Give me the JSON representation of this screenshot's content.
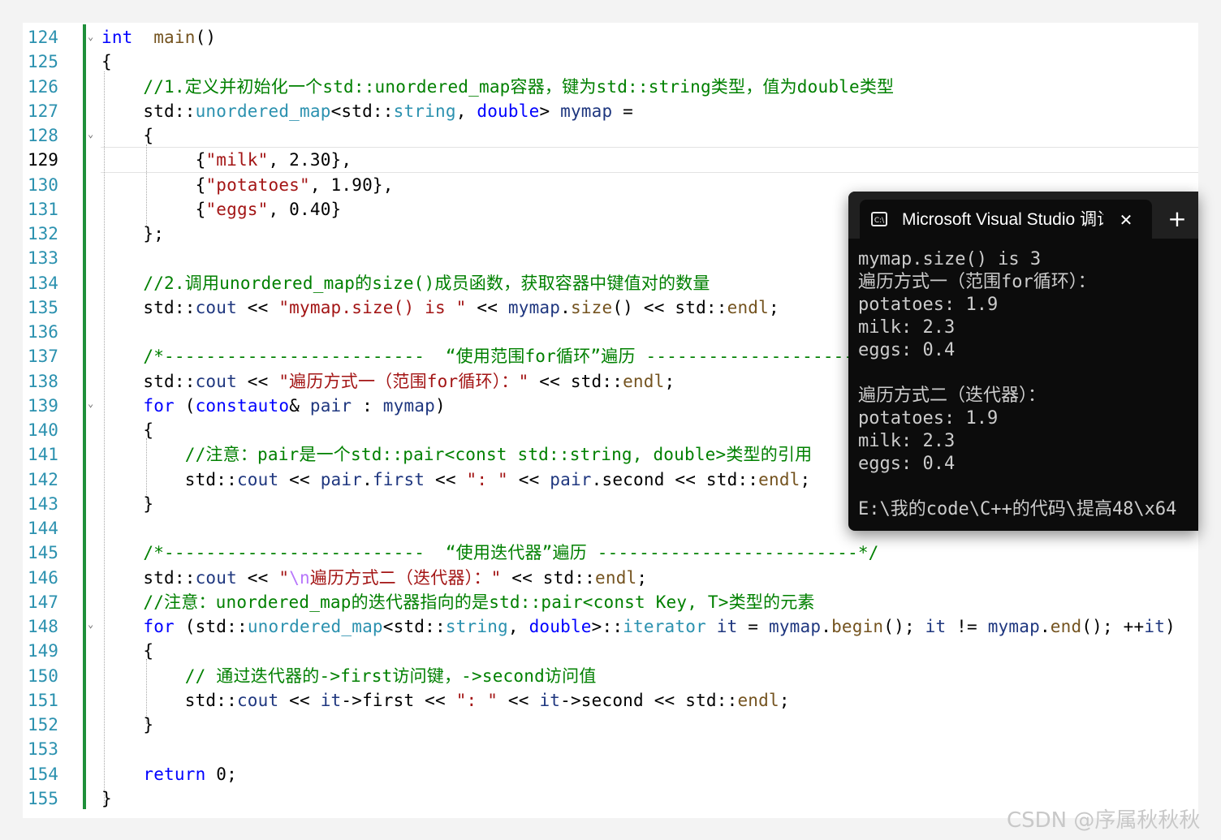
{
  "editor": {
    "active_line": "129",
    "line_numbers": [
      "124",
      "125",
      "126",
      "127",
      "128",
      "129",
      "130",
      "131",
      "132",
      "133",
      "134",
      "135",
      "136",
      "137",
      "138",
      "139",
      "140",
      "141",
      "142",
      "143",
      "144",
      "145",
      "146",
      "147",
      "148",
      "149",
      "150",
      "151",
      "152",
      "153",
      "154",
      "155"
    ],
    "lines": [
      [
        [
          "kw",
          "int"
        ],
        [
          "",
          "  "
        ],
        [
          "fn",
          "main"
        ],
        [
          "",
          "()"
        ]
      ],
      [
        [
          "",
          "{"
        ]
      ],
      [
        [
          "",
          "    "
        ],
        [
          "cm",
          "//1.定义并初始化一个std::unordered_map容器，键为std::string类型，值为double类型"
        ]
      ],
      [
        [
          "",
          "    std::"
        ],
        [
          "ty",
          "unordered_map"
        ],
        [
          "",
          "<std::"
        ],
        [
          "ty",
          "string"
        ],
        [
          "",
          ", "
        ],
        [
          "kw",
          "double"
        ],
        [
          "",
          "> "
        ],
        [
          "var",
          "mymap"
        ],
        [
          "",
          " ="
        ]
      ],
      [
        [
          "",
          "    {"
        ]
      ],
      [
        [
          "",
          "         {"
        ],
        [
          "st",
          "\"milk\""
        ],
        [
          "",
          ", 2.30},"
        ]
      ],
      [
        [
          "",
          "         {"
        ],
        [
          "st",
          "\"potatoes\""
        ],
        [
          "",
          ", 1.90},"
        ]
      ],
      [
        [
          "",
          "         {"
        ],
        [
          "st",
          "\"eggs\""
        ],
        [
          "",
          ", 0.40}"
        ]
      ],
      [
        [
          "",
          "    };"
        ]
      ],
      [
        [
          "",
          ""
        ]
      ],
      [
        [
          "",
          "    "
        ],
        [
          "cm",
          "//2.调用unordered_map的size()成员函数，获取容器中键值对的数量"
        ]
      ],
      [
        [
          "",
          "    std::"
        ],
        [
          "var",
          "cout"
        ],
        [
          "",
          " << "
        ],
        [
          "st",
          "\"mymap.size() is \""
        ],
        [
          "",
          " << "
        ],
        [
          "var",
          "mymap"
        ],
        [
          "",
          "."
        ],
        [
          "fn",
          "size"
        ],
        [
          "",
          "() << std::"
        ],
        [
          "fn",
          "endl"
        ],
        [
          "",
          ";"
        ]
      ],
      [
        [
          "",
          ""
        ]
      ],
      [
        [
          "",
          "    "
        ],
        [
          "cm",
          "/*-------------------------  “使用范围for循环”遍历 -------------------------*/"
        ]
      ],
      [
        [
          "",
          "    std::"
        ],
        [
          "var",
          "cout"
        ],
        [
          "",
          " << "
        ],
        [
          "st",
          "\"遍历方式一（范围for循环）：\""
        ],
        [
          "",
          " << std::"
        ],
        [
          "fn",
          "endl"
        ],
        [
          "",
          ";"
        ]
      ],
      [
        [
          "",
          "    "
        ],
        [
          "kw",
          "for"
        ],
        [
          "",
          " ("
        ],
        [
          "kw",
          "const"
        ],
        [
          "",
          "",
          " "
        ],
        [
          "kw",
          "auto"
        ],
        [
          "",
          "& "
        ],
        [
          "var",
          "pair"
        ],
        [
          "",
          " : "
        ],
        [
          "var",
          "mymap"
        ],
        [
          "",
          ")"
        ]
      ],
      [
        [
          "",
          "    {"
        ]
      ],
      [
        [
          "",
          "        "
        ],
        [
          "cm",
          "//注意：pair是一个std::pair<const std::string, double>类型的引用"
        ]
      ],
      [
        [
          "",
          "        std::"
        ],
        [
          "var",
          "cout"
        ],
        [
          "",
          " << "
        ],
        [
          "var",
          "pair"
        ],
        [
          "",
          "."
        ],
        [
          "var",
          "first"
        ],
        [
          "",
          " << "
        ],
        [
          "st",
          "\": \""
        ],
        [
          "",
          " << "
        ],
        [
          "var",
          "pair"
        ],
        [
          "",
          ".second << std::"
        ],
        [
          "fn",
          "endl"
        ],
        [
          "",
          ";"
        ]
      ],
      [
        [
          "",
          "    }"
        ]
      ],
      [
        [
          "",
          ""
        ]
      ],
      [
        [
          "",
          "    "
        ],
        [
          "cm",
          "/*-------------------------  “使用迭代器”遍历 -------------------------*/"
        ]
      ],
      [
        [
          "",
          "    std::"
        ],
        [
          "var",
          "cout"
        ],
        [
          "",
          " << "
        ],
        [
          "st",
          "\""
        ],
        [
          "esc",
          "\\n"
        ],
        [
          "st",
          "遍历方式二（迭代器）：\""
        ],
        [
          "",
          " << std::"
        ],
        [
          "fn",
          "endl"
        ],
        [
          "",
          ";"
        ]
      ],
      [
        [
          "",
          "    "
        ],
        [
          "cm",
          "//注意：unordered_map的迭代器指向的是std::pair<const Key, T>类型的元素"
        ]
      ],
      [
        [
          "",
          "    "
        ],
        [
          "kw",
          "for"
        ],
        [
          "",
          " (std::"
        ],
        [
          "ty",
          "unordered_map"
        ],
        [
          "",
          "<std::"
        ],
        [
          "ty",
          "string"
        ],
        [
          "",
          ", "
        ],
        [
          "kw",
          "double"
        ],
        [
          "",
          ">::"
        ],
        [
          "ty",
          "iterator"
        ],
        [
          "",
          " "
        ],
        [
          "var",
          "it"
        ],
        [
          "",
          " = "
        ],
        [
          "var",
          "mymap"
        ],
        [
          "",
          "."
        ],
        [
          "fn",
          "begin"
        ],
        [
          "",
          "(); "
        ],
        [
          "var",
          "it"
        ],
        [
          "",
          " != "
        ],
        [
          "var",
          "mymap"
        ],
        [
          "",
          "."
        ],
        [
          "fn",
          "end"
        ],
        [
          "",
          "(); ++"
        ],
        [
          "var",
          "it"
        ],
        [
          "",
          ")"
        ]
      ],
      [
        [
          "",
          "    {"
        ]
      ],
      [
        [
          "",
          "        "
        ],
        [
          "cm",
          "// 通过迭代器的->first访问键，->second访问值"
        ]
      ],
      [
        [
          "",
          "        std::"
        ],
        [
          "var",
          "cout"
        ],
        [
          "",
          " << "
        ],
        [
          "var",
          "it"
        ],
        [
          "",
          "->first << "
        ],
        [
          "st",
          "\": \""
        ],
        [
          "",
          " << "
        ],
        [
          "var",
          "it"
        ],
        [
          "",
          "->second << std::"
        ],
        [
          "fn",
          "endl"
        ],
        [
          "",
          ";"
        ]
      ],
      [
        [
          "",
          "    }"
        ]
      ],
      [
        [
          "",
          ""
        ]
      ],
      [
        [
          "",
          "    "
        ],
        [
          "kw",
          "return"
        ],
        [
          "",
          " 0;"
        ]
      ],
      [
        [
          "",
          "}"
        ]
      ]
    ]
  },
  "console": {
    "tab_title": "Microsoft Visual Studio 调试控制台",
    "tab_icon": "terminal-icon",
    "close_label": "✕",
    "newtab_label": "+",
    "output": [
      "mymap.size() is 3",
      "遍历方式一（范围for循环）：",
      "potatoes: 1.9",
      "milk: 2.3",
      "eggs: 0.4",
      "",
      "遍历方式二（迭代器）：",
      "potatoes: 1.9",
      "milk: 2.3",
      "eggs: 0.4",
      "",
      "E:\\我的code\\C++的代码\\提高48\\x64"
    ]
  },
  "watermark": "CSDN @序属秋秋秋",
  "colors": {
    "keyword": "#0000ff",
    "type": "#2b91af",
    "comment": "#008000",
    "string": "#a31515",
    "change_bar": "#1e8f3a",
    "console_bg": "#0c0c0c"
  }
}
